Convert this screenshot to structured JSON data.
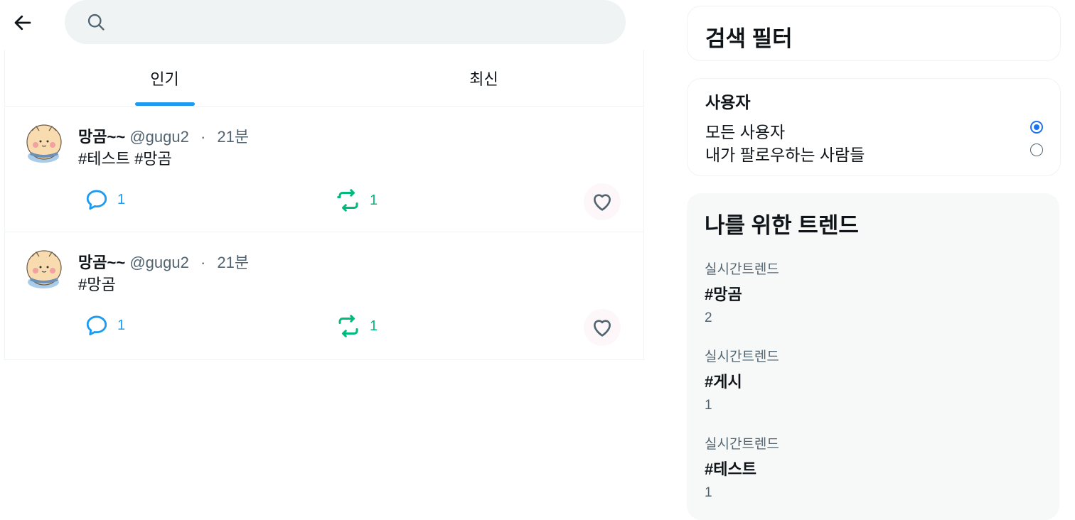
{
  "search": {
    "placeholder": ""
  },
  "tabs": [
    {
      "label": "인기",
      "active": true
    },
    {
      "label": "최신",
      "active": false
    }
  ],
  "posts": [
    {
      "name": "망곰~~",
      "handle": "@gugu2",
      "time": "21분",
      "text": "#테스트 #망곰",
      "replies": "1",
      "retweets": "1"
    },
    {
      "name": "망곰~~",
      "handle": "@gugu2",
      "time": "21분",
      "text": "#망곰",
      "replies": "1",
      "retweets": "1"
    }
  ],
  "filters": {
    "title": "검색 필터",
    "users_label": "사용자",
    "options": [
      {
        "label": "모든 사용자",
        "selected": true
      },
      {
        "label": "내가 팔로우하는 사람들",
        "selected": false
      }
    ]
  },
  "trends": {
    "title": "나를 위한 트렌드",
    "items": [
      {
        "category": "실시간트렌드",
        "tag": "#망곰",
        "count": "2"
      },
      {
        "category": "실시간트렌드",
        "tag": "#게시",
        "count": "1"
      },
      {
        "category": "실시간트렌드",
        "tag": "#테스트",
        "count": "1"
      }
    ]
  },
  "colors": {
    "accent": "#1d9bf0",
    "retweet": "#00ba7c",
    "muted": "#536471"
  },
  "icons": {
    "back": "arrow-left-icon",
    "search": "search-icon",
    "reply": "reply-icon",
    "retweet": "retweet-icon",
    "like": "heart-icon"
  }
}
